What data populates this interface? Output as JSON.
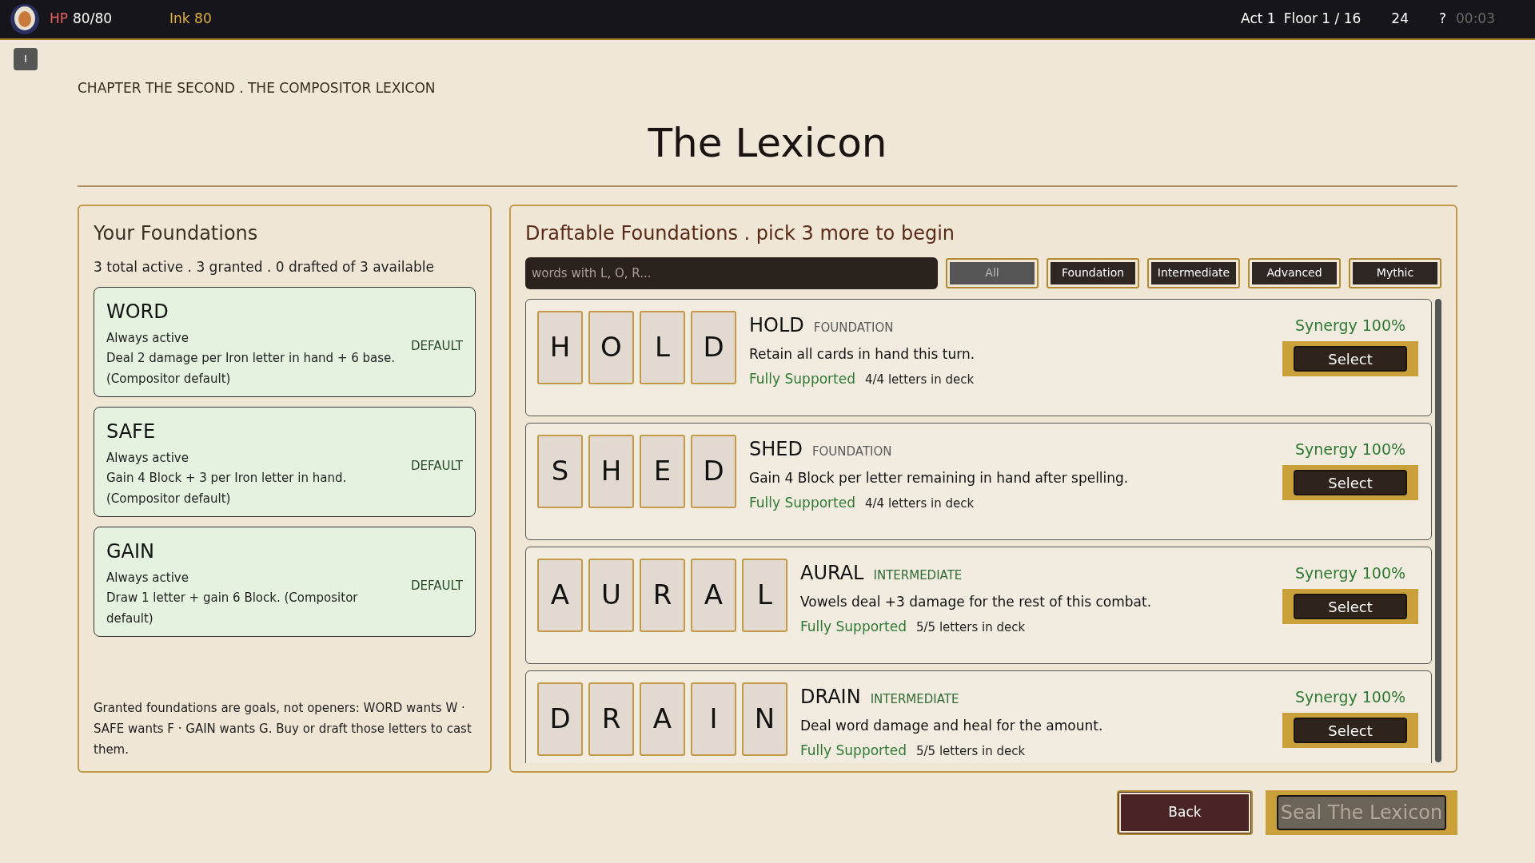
{
  "top_bar": {
    "hp_label": "HP",
    "hp_value": "80/80",
    "ink": "Ink 80",
    "act": "Act 1",
    "floor": "Floor 1 / 16",
    "count": "24",
    "help": "?",
    "timer": "00:03"
  },
  "side_button": "I",
  "chapter": "CHAPTER THE SECOND . THE COMPOSITOR LEXICON",
  "title": "The Lexicon",
  "foundations": {
    "title": "Your Foundations",
    "summary": "3 total active . 3 granted . 0 drafted of 3 available",
    "items": [
      {
        "word": "WORD",
        "status": "Always active",
        "effect": "Deal 2 damage per Iron letter in hand + 6 base. (Compositor default)",
        "tag": "DEFAULT"
      },
      {
        "word": "SAFE",
        "status": "Always active",
        "effect": "Gain 4 Block + 3 per Iron letter in hand. (Compositor default)",
        "tag": "DEFAULT"
      },
      {
        "word": "GAIN",
        "status": "Always active",
        "effect": "Draw 1 letter + gain 6 Block. (Compositor default)",
        "tag": "DEFAULT"
      }
    ],
    "note": "Granted foundations are goals, not openers: WORD wants W · SAFE wants F · GAIN wants G. Buy or draft those letters to cast them."
  },
  "draftable": {
    "title": "Draftable Foundations . pick 3 more to begin",
    "search": {
      "placeholder": "words with L, O, R..."
    },
    "filters": [
      {
        "label": "All",
        "selected": true
      },
      {
        "label": "Foundation",
        "selected": false
      },
      {
        "label": "Intermediate",
        "selected": false
      },
      {
        "label": "Advanced",
        "selected": false
      },
      {
        "label": "Mythic",
        "selected": false
      }
    ],
    "items": [
      {
        "letters": [
          "H",
          "O",
          "L",
          "D"
        ],
        "word": "HOLD",
        "tier": "FOUNDATION",
        "kind": "foundation",
        "effect": "Retain all cards in hand this turn.",
        "support": "Fully Supported",
        "deck": "4/4 letters in deck",
        "synergy": "Synergy 100%",
        "button": "Select"
      },
      {
        "letters": [
          "S",
          "H",
          "E",
          "D"
        ],
        "word": "SHED",
        "tier": "FOUNDATION",
        "kind": "foundation",
        "effect": "Gain 4 Block per letter remaining in hand after spelling.",
        "support": "Fully Supported",
        "deck": "4/4 letters in deck",
        "synergy": "Synergy 100%",
        "button": "Select"
      },
      {
        "letters": [
          "A",
          "U",
          "R",
          "A",
          "L"
        ],
        "word": "AURAL",
        "tier": "INTERMEDIATE",
        "kind": "intermediate",
        "effect": "Vowels deal +3 damage for the rest of this combat.",
        "support": "Fully Supported",
        "deck": "5/5 letters in deck",
        "synergy": "Synergy 100%",
        "button": "Select"
      },
      {
        "letters": [
          "D",
          "R",
          "A",
          "I",
          "N"
        ],
        "word": "DRAIN",
        "tier": "INTERMEDIATE",
        "kind": "intermediate",
        "effect": "Deal word damage and heal for the amount.",
        "support": "Fully Supported",
        "deck": "5/5 letters in deck",
        "synergy": "Synergy 100%",
        "button": "Select"
      }
    ]
  },
  "footer": {
    "back": "Back",
    "seal": {
      "label": "Seal The Lexicon",
      "disabled": true
    }
  }
}
